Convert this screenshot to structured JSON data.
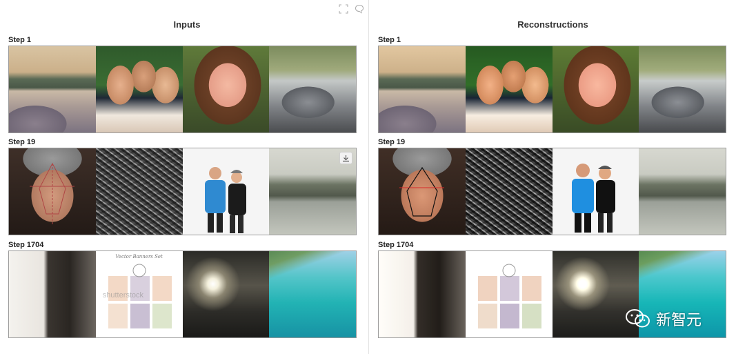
{
  "panels": {
    "left": {
      "title": "Inputs",
      "steps": [
        {
          "label": "Step 1"
        },
        {
          "label": "Step 19"
        },
        {
          "label": "Step 1704"
        }
      ]
    },
    "right": {
      "title": "Reconstructions",
      "steps": [
        {
          "label": "Step 1"
        },
        {
          "label": "Step 19"
        },
        {
          "label": "Step 1704"
        }
      ]
    }
  },
  "toolbar": {
    "icons": [
      "expand-icon",
      "comment-icon"
    ]
  },
  "tile_icons": {
    "download": "download-icon"
  },
  "vector_card": {
    "title": "Vector Banners Set",
    "watermark": "shutterstock"
  },
  "watermark": {
    "text": "新智元",
    "icon": "wechat-icon"
  },
  "colors": {
    "border": "#9b9b9b",
    "divider": "#e3e3e3",
    "title_text": "#333333"
  }
}
